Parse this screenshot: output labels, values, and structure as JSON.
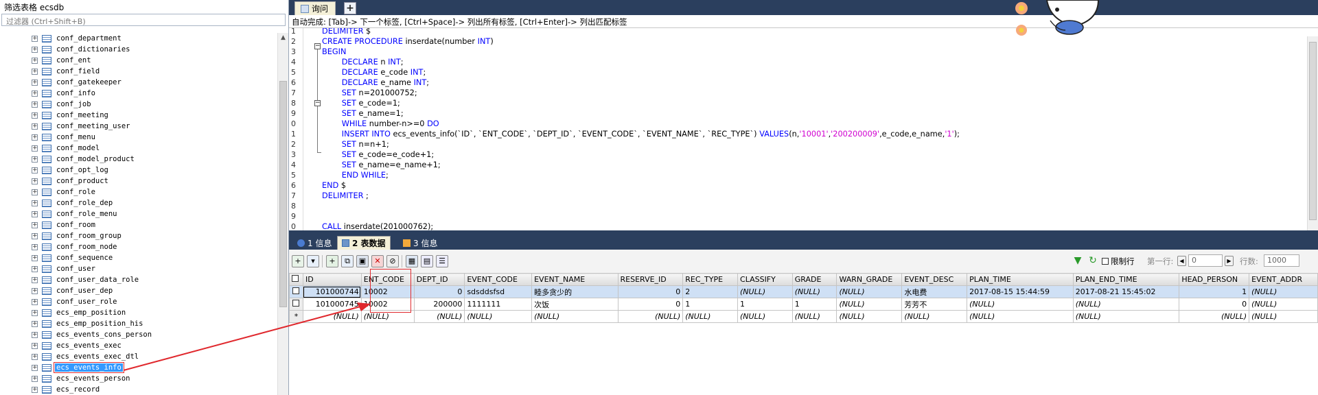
{
  "left_panel": {
    "title": "筛选表格 ecsdb",
    "filter_placeholder": "过滤器 (Ctrl+Shift+B)",
    "tables": [
      "conf_department",
      "conf_dictionaries",
      "conf_ent",
      "conf_field",
      "conf_gatekeeper",
      "conf_info",
      "conf_job",
      "conf_meeting",
      "conf_meeting_user",
      "conf_menu",
      "conf_model",
      "conf_model_product",
      "conf_opt_log",
      "conf_product",
      "conf_role",
      "conf_role_dep",
      "conf_role_menu",
      "conf_room",
      "conf_room_group",
      "conf_room_node",
      "conf_sequence",
      "conf_user",
      "conf_user_data_role",
      "conf_user_dep",
      "conf_user_role",
      "ecs_emp_position",
      "ecs_emp_position_his",
      "ecs_events_cons_person",
      "ecs_events_exec",
      "ecs_events_exec_dtl",
      "ecs_events_info",
      "ecs_events_person",
      "ecs_record"
    ],
    "selected_table": "ecs_events_info"
  },
  "query_tab": {
    "label": "询问",
    "add_label": "+"
  },
  "autocomplete_hint": "自动完成: [Tab]-> 下一个标签, [Ctrl+Space]-> 列出所有标签, [Ctrl+Enter]-> 列出匹配标签",
  "line_numbers": [
    "1",
    "2",
    "3",
    "4",
    "5",
    "6",
    "7",
    "8",
    "9",
    "0",
    "1",
    "2",
    "3",
    "4",
    "5",
    "6",
    "7",
    "8",
    "9",
    "0"
  ],
  "result_tabs": [
    {
      "label": "1 信息",
      "icon": "info-icon"
    },
    {
      "label": "2 表数据",
      "icon": "table-data-icon"
    },
    {
      "label": "3 信息",
      "icon": "info-icon"
    }
  ],
  "toolbar": {
    "limit_label": "限制行",
    "first_row_label": "第一行:",
    "first_row_value": "0",
    "rows_label": "行数:",
    "rows_value": "1000"
  },
  "grid": {
    "columns": [
      "ID",
      "ENT_CODE",
      "DEPT_ID",
      "EVENT_CODE",
      "EVENT_NAME",
      "RESERVE_ID",
      "REC_TYPE",
      "CLASSIFY",
      "GRADE",
      "WARN_GRADE",
      "EVENT_DESC",
      "PLAN_TIME",
      "PLAN_END_TIME",
      "HEAD_PERSON",
      "EVENT_ADDR"
    ],
    "rows": [
      [
        "101000744",
        "10002",
        "0",
        "sdsddsfsd",
        "睦多贪少的",
        "0",
        "2",
        "(NULL)",
        "(NULL)",
        "(NULL)",
        "水电费",
        "2017-08-15 15:44:59",
        "2017-08-21 15:45:02",
        "1",
        "(NULL)"
      ],
      [
        "101000745",
        "10002",
        "200000",
        "1111111",
        "次饭",
        "0",
        "1",
        "1",
        "1",
        "(NULL)",
        "芳芳不",
        "(NULL)",
        "(NULL)",
        "0",
        "(NULL)"
      ],
      [
        "(NULL)",
        "(NULL)",
        "(NULL)",
        "(NULL)",
        "(NULL)",
        "(NULL)",
        "(NULL)",
        "(NULL)",
        "(NULL)",
        "(NULL)",
        "(NULL)",
        "(NULL)",
        "(NULL)",
        "(NULL)",
        "(NULL)"
      ]
    ],
    "new_row_marker": "*"
  },
  "colors": {
    "dark_bar": "#2b3f5e",
    "keyword": "#0000ff",
    "string": "#d000d0",
    "annotation": "#e0282d",
    "selected_row": "#cfe0f5"
  }
}
